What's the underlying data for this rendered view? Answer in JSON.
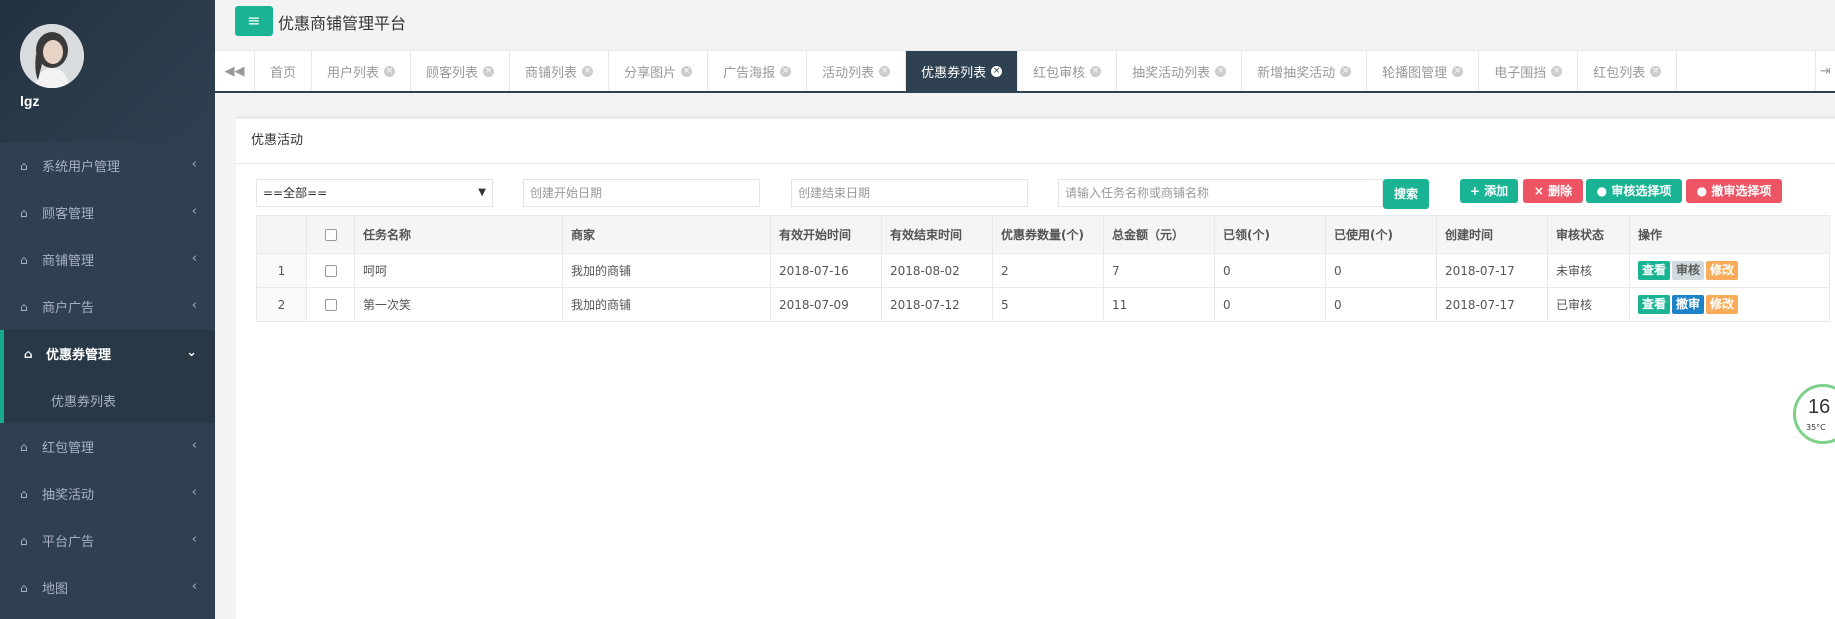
{
  "app": {
    "title": "优惠商铺管理平台",
    "menu_icon": "hamburger-icon"
  },
  "user": {
    "name": "lgz"
  },
  "sidebar": {
    "items": [
      {
        "label": "系统用户管理",
        "icon": "home-icon",
        "expanded": false
      },
      {
        "label": "顾客管理",
        "icon": "home-icon",
        "expanded": false
      },
      {
        "label": "商铺管理",
        "icon": "home-icon",
        "expanded": false
      },
      {
        "label": "商户广告",
        "icon": "home-icon",
        "expanded": false
      },
      {
        "label": "优惠券管理",
        "icon": "home-icon",
        "expanded": true,
        "sub": [
          "优惠券列表"
        ]
      },
      {
        "label": "红包管理",
        "icon": "home-icon",
        "expanded": false
      },
      {
        "label": "抽奖活动",
        "icon": "home-icon",
        "expanded": false
      },
      {
        "label": "平台广告",
        "icon": "home-icon",
        "expanded": false
      },
      {
        "label": "地图",
        "icon": "home-icon",
        "expanded": false
      }
    ]
  },
  "tabs": [
    {
      "label": "首页",
      "closable": false
    },
    {
      "label": "用户列表",
      "closable": true
    },
    {
      "label": "顾客列表",
      "closable": true
    },
    {
      "label": "商铺列表",
      "closable": true
    },
    {
      "label": "分享图片",
      "closable": true
    },
    {
      "label": "广告海报",
      "closable": true
    },
    {
      "label": "活动列表",
      "closable": true
    },
    {
      "label": "优惠券列表",
      "closable": true,
      "active": true
    },
    {
      "label": "红包审核",
      "closable": true
    },
    {
      "label": "抽奖活动列表",
      "closable": true
    },
    {
      "label": "新增抽奖活动",
      "closable": true
    },
    {
      "label": "轮播图管理",
      "closable": true
    },
    {
      "label": "电子围挡",
      "closable": true
    },
    {
      "label": "红包列表",
      "closable": true
    }
  ],
  "panel": {
    "title": "优惠活动",
    "filter": {
      "select_value": "==全部==",
      "start_placeholder": "创建开始日期",
      "end_placeholder": "创建结束日期",
      "search_placeholder": "请输入任务名称或商铺名称",
      "search_label": "搜索"
    },
    "actions": {
      "add": "添加",
      "delete": "删除",
      "approve": "审核选择项",
      "revoke": "撤审选择项"
    },
    "table": {
      "headers": [
        "任务名称",
        "商家",
        "有效开始时间",
        "有效结束时间",
        "优惠券数量(个)",
        "总金额（元）",
        "已领(个)",
        "已使用(个)",
        "创建时间",
        "审核状态",
        "操作"
      ],
      "rows": [
        {
          "index": "1",
          "name": "呵呵",
          "shop": "我加的商铺",
          "start": "2018-07-16",
          "end": "2018-08-02",
          "count": "2",
          "amount": "7",
          "received": "0",
          "used": "0",
          "created": "2018-07-17",
          "status": "未审核",
          "ops": [
            "查看",
            "审核",
            "修改"
          ]
        },
        {
          "index": "2",
          "name": "第一次笑",
          "shop": "我加的商铺",
          "start": "2018-07-09",
          "end": "2018-07-12",
          "count": "5",
          "amount": "11",
          "received": "0",
          "used": "0",
          "created": "2018-07-17",
          "status": "已审核",
          "ops": [
            "查看",
            "撤审",
            "修改"
          ]
        }
      ]
    }
  },
  "widget": {
    "value": "16",
    "unit": "%",
    "temp": "35°C"
  },
  "colors": {
    "sidebar": "#2f4050",
    "accent": "#1ab394",
    "danger": "#ed5565",
    "warning": "#f8ac59",
    "info": "#1c84c6"
  }
}
